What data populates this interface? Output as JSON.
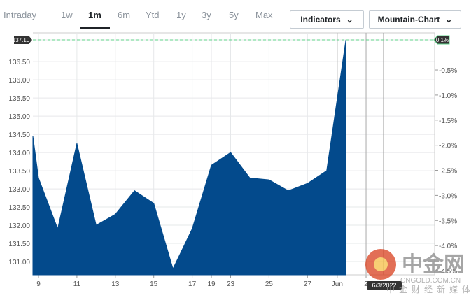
{
  "tabs": [
    "Intraday",
    "1w",
    "1m",
    "6m",
    "Ytd",
    "1y",
    "3y",
    "5y",
    "Max"
  ],
  "active_tab": "1m",
  "buttons": {
    "indicators": "Indicators",
    "chart_type": "Mountain-Chart"
  },
  "colors": {
    "fill": "#034a8c",
    "line": "#034a8c",
    "dash": "#5fd38a",
    "grid": "#e6e8ea"
  },
  "watermark": {
    "brand": "中金网",
    "url": "CNGOLD.COM.CN",
    "slogan": "中金财经新媒体"
  },
  "chart_data": {
    "type": "area",
    "ylim": [
      130.7,
      137.3
    ],
    "y_ticks": [
      "137.10",
      "136.50",
      "136.00",
      "135.50",
      "135.00",
      "134.50",
      "134.00",
      "133.50",
      "133.00",
      "132.50",
      "132.00",
      "131.50",
      "131.00"
    ],
    "y_tick_values": [
      137.1,
      136.5,
      136,
      135.5,
      135,
      134.5,
      134,
      133.5,
      133,
      132.5,
      132,
      131.5,
      131
    ],
    "right_ticks": [
      "0.1%",
      "-0.5%",
      "-1.0%",
      "-1.5%",
      "-2.0%",
      "-2.5%",
      "-3.0%",
      "-3.5%",
      "-4.0%",
      "-4.5%"
    ],
    "right_tick_values": [
      0.1,
      -0.5,
      -1.0,
      -1.5,
      -2.0,
      -2.5,
      -3.0,
      -3.5,
      -4.0,
      -4.5
    ],
    "x_labels": [
      "9",
      "11",
      "13",
      "15",
      "17",
      "19",
      "23",
      "25",
      "27",
      "Jun",
      "2"
    ],
    "x_label_index": [
      0,
      2,
      4,
      6,
      8,
      9,
      10,
      12,
      14,
      15.55,
      17.05
    ],
    "x": [
      -0.3,
      0,
      1,
      2,
      3,
      4,
      5,
      6,
      7,
      8,
      9,
      10,
      11,
      12,
      13,
      14,
      15,
      16
    ],
    "values": [
      134.45,
      133.3,
      131.9,
      134.25,
      132.0,
      132.3,
      132.95,
      132.6,
      130.8,
      131.9,
      133.65,
      134.0,
      133.3,
      133.25,
      132.95,
      133.15,
      133.5,
      137.1
    ],
    "last_label": "137.10",
    "last_pct": "0.1%",
    "tooltip_date": "6/3/2022"
  }
}
